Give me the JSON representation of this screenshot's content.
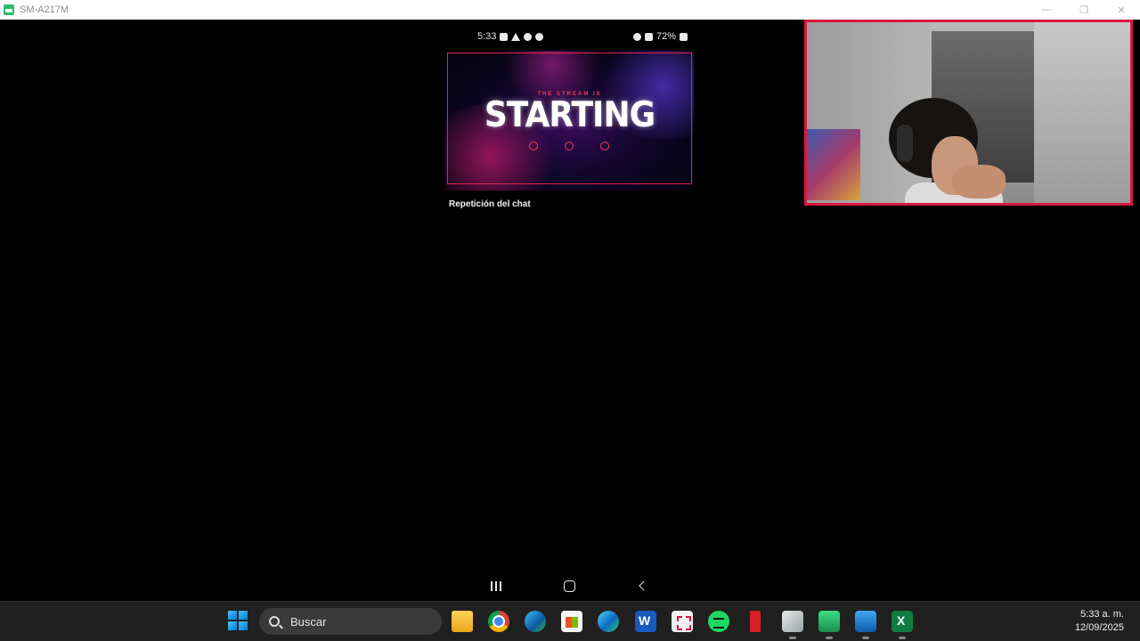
{
  "window": {
    "title": "SM-A217M",
    "icon": "android-mirror-icon",
    "controls": [
      "minimize",
      "maximize",
      "close"
    ]
  },
  "phone": {
    "status_bar": {
      "time": "5:33",
      "battery": "72%"
    },
    "video": {
      "overline": "THE STREAM IS",
      "headline": "STARTING"
    },
    "chat_replay_label": "Repetición del chat",
    "nav": [
      "recents",
      "home",
      "back"
    ]
  },
  "webcam": {
    "border_color": "#d9163f"
  },
  "taskbar": {
    "search_placeholder": "Buscar",
    "pinned": [
      "file-explorer",
      "chrome",
      "edge",
      "microsoft-store",
      "edge-profile",
      "word",
      "snipping-tool",
      "spotify",
      "netflix",
      "app",
      "android-mirror",
      "photos",
      "excel"
    ],
    "clock": {
      "time": "5:33 a. m.",
      "date": "12/09/2025"
    }
  },
  "colors": {
    "accent": "#d9163f",
    "taskbar_bg": "#202020"
  }
}
